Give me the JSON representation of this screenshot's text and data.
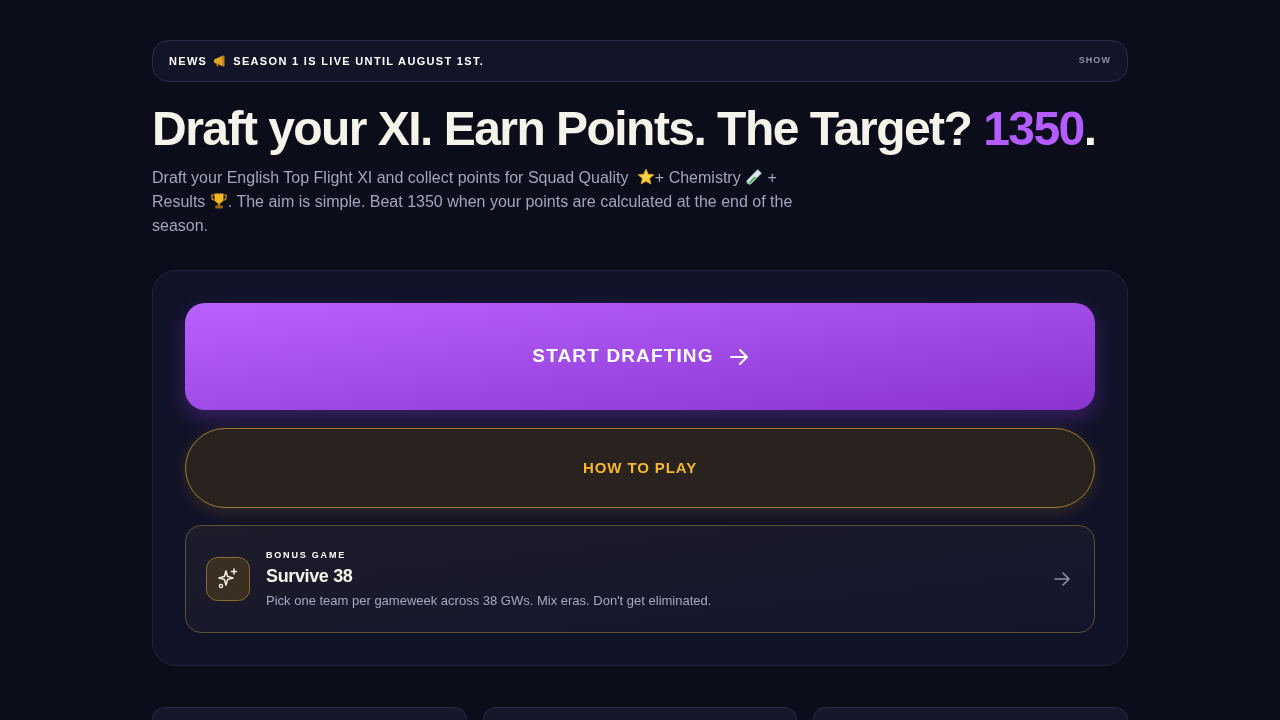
{
  "news": {
    "label": "NEWS",
    "message": "SEASON 1 IS LIVE UNTIL AUGUST 1ST.",
    "toggle": "SHOW"
  },
  "headline": [
    {
      "text": "Draft your XI. Earn Points. The Target? ",
      "highlight": false
    },
    {
      "text": "1350",
      "highlight": true
    },
    {
      "text": ".",
      "highlight": false
    }
  ],
  "intro": [
    "Draft your English Top Flight XI and collect points for Squad Quality",
    "+ Chemistry",
    "+",
    "Results",
    ". The aim is simple. Beat 1350 when your points are calculated at the end of the",
    "season."
  ],
  "actions": {
    "primary": "START DRAFTING",
    "secondary": "HOW TO PLAY"
  },
  "bonus_game": {
    "eyebrow": "BONUS GAME",
    "title": "Survive 38",
    "description": "Pick one team per gameweek across 38 GWs. Mix eras. Don't get eliminated."
  }
}
